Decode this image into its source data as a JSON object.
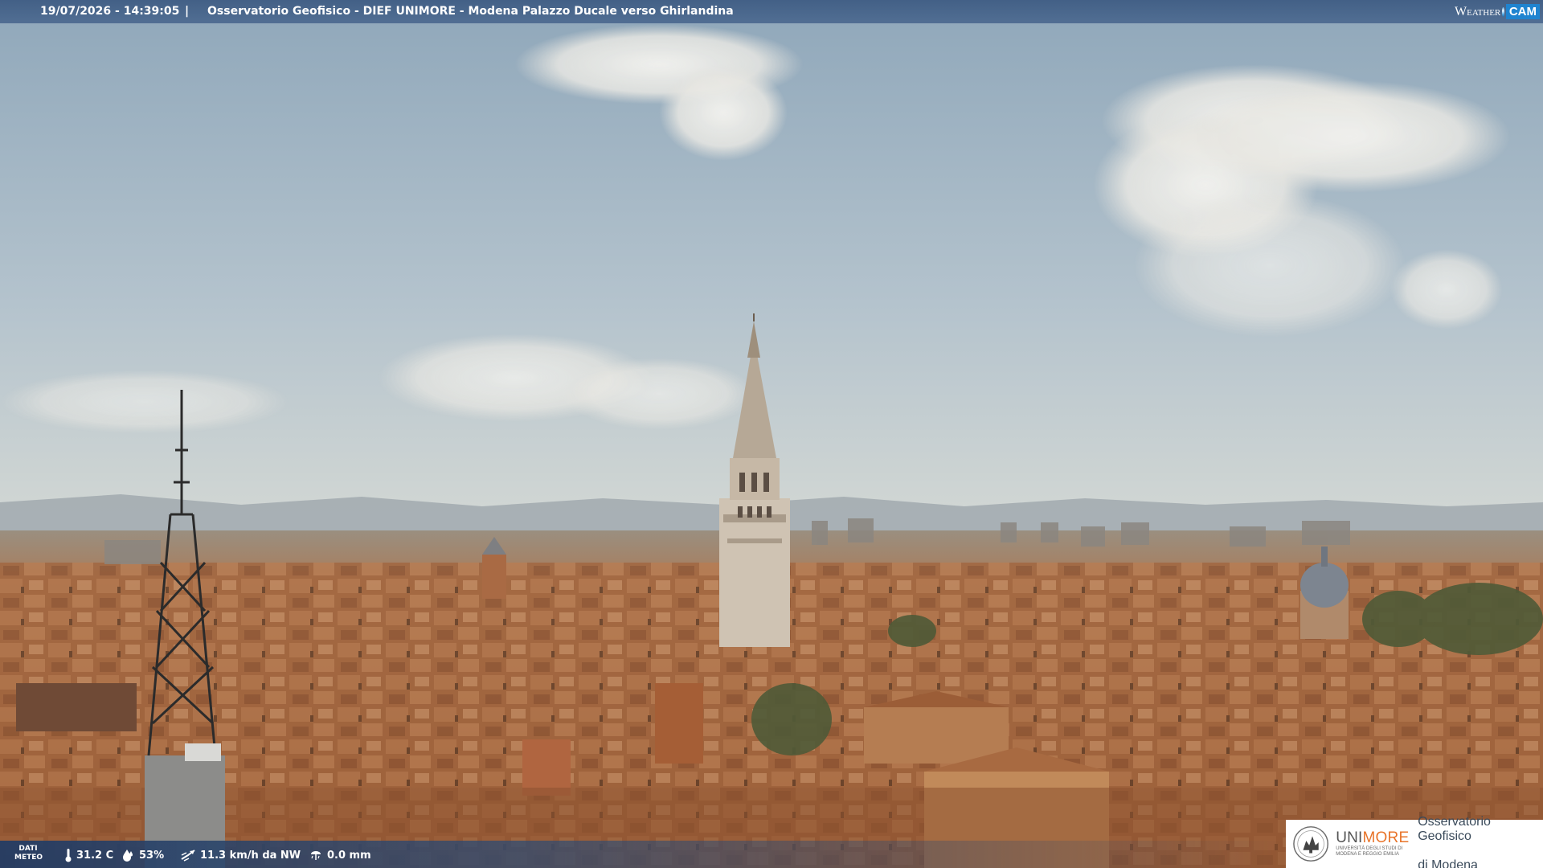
{
  "overlay": {
    "timestamp": "19/07/2026 - 14:39:05",
    "separator": "|",
    "title": "Osservatorio Geofisico - DIEF UNIMORE - Modena Palazzo Ducale verso Ghirlandina"
  },
  "brand": {
    "weather": "Weather",
    "cam": "CAM"
  },
  "weather_data": {
    "label": "DATI\nMETEO",
    "label_line1": "DATI",
    "label_line2": "METEO",
    "temperature": "31.2 C",
    "humidity": "53%",
    "wind": "11.3 km/h da NW",
    "rain": "0.0 mm"
  },
  "logo": {
    "uni_part1": "UNI",
    "uni_part2": "MORE",
    "uni_subtitle_line1": "UNIVERSITÀ DEGLI STUDI DI",
    "uni_subtitle_line2": "MODENA E REGGIO EMILIA",
    "observatory_line1": "Osservatorio Geofisico",
    "observatory_line2": "di Modena"
  },
  "colors": {
    "sky_top": "#9fb3c3",
    "sky_horizon": "#d9dcd6",
    "roofs": "#a4673f",
    "bar": "#3c5a82",
    "unimore_orange": "#e8742a"
  }
}
